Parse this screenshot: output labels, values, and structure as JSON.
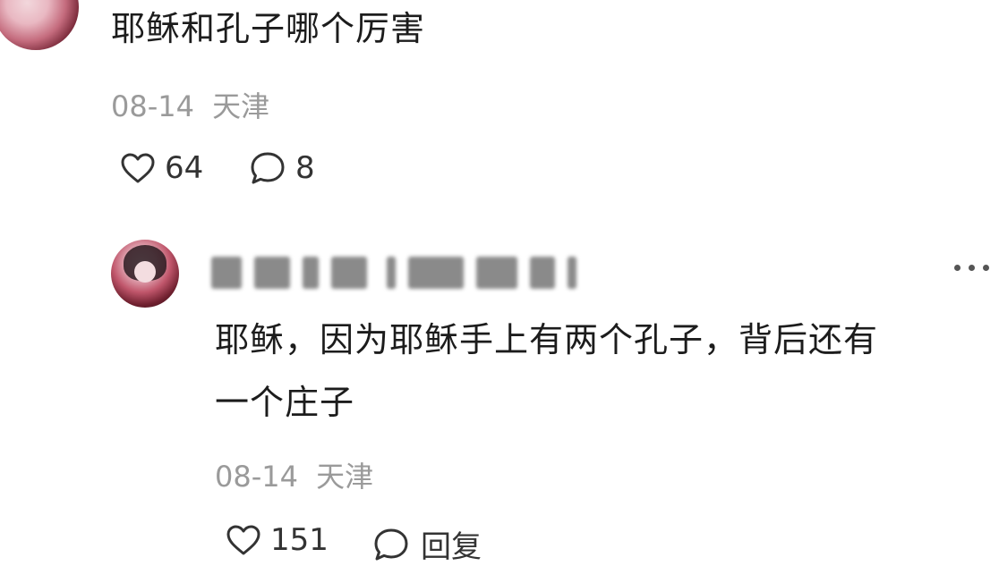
{
  "top_comment": {
    "text": "耶稣和孔子哪个厉害",
    "date": "08-14",
    "location": "天津",
    "like_count": "64",
    "reply_count": "8"
  },
  "reply": {
    "username": "",
    "text_line1": "耶稣，因为耶稣手上有两个孔子，背后还有",
    "text_line2": "一个庄子",
    "date": "08-14",
    "location": "天津",
    "like_count": "151",
    "reply_label": "回复"
  },
  "icons": {
    "like": "heart-outline-icon",
    "comment": "speech-bubble-icon",
    "more": "more-dots-icon"
  }
}
